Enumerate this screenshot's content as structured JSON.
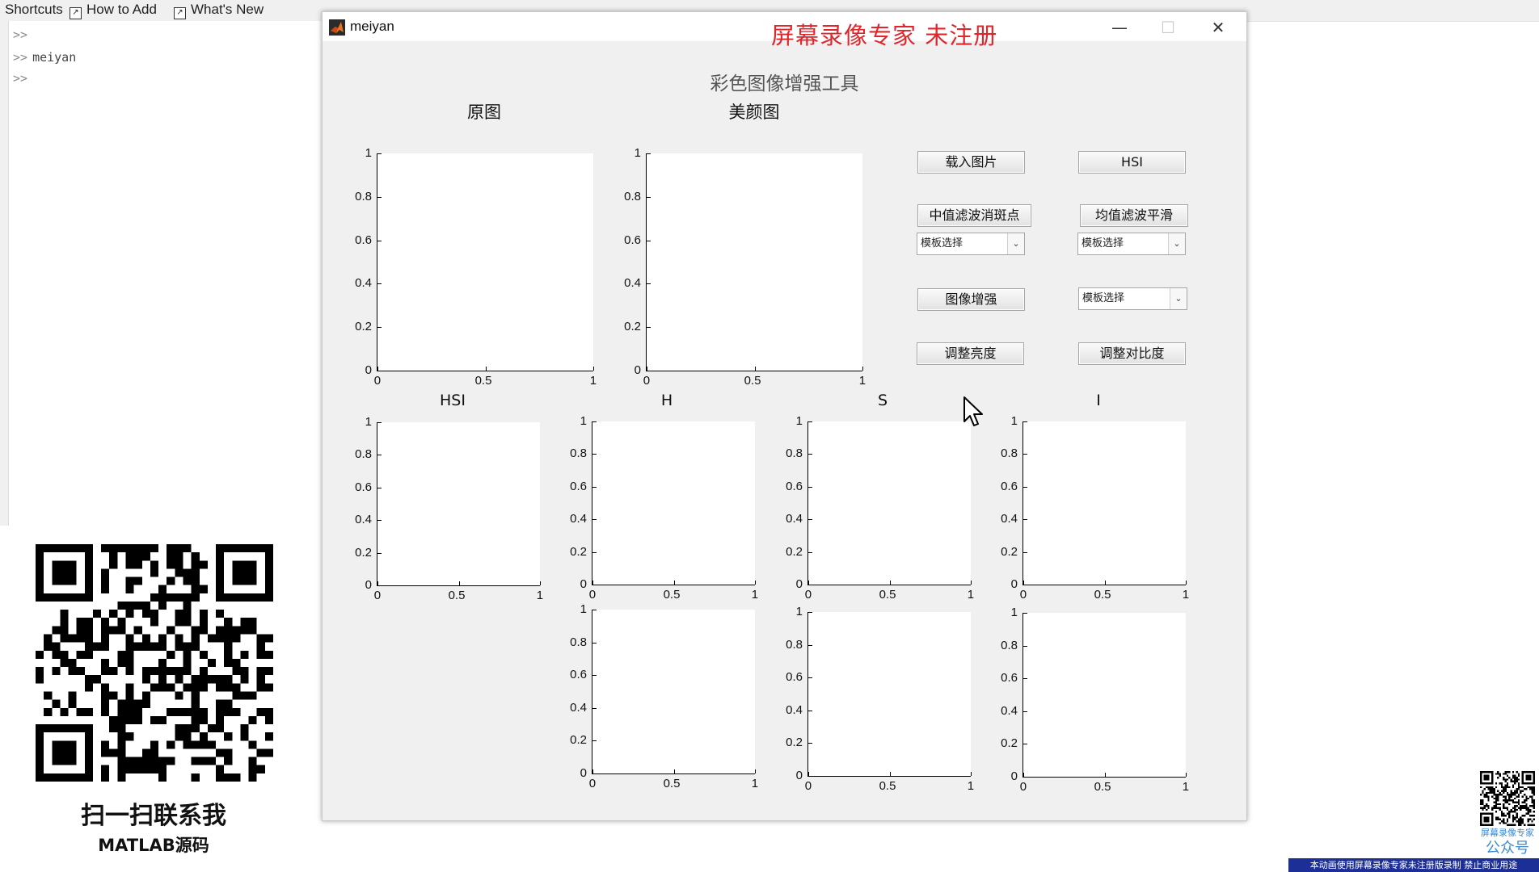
{
  "toolbar": {
    "shortcuts": "Shortcuts",
    "how_to_add": "How to Add",
    "whats_new": "What's New"
  },
  "command_window": {
    "prompt": ">>",
    "lines": [
      "",
      "meiyan",
      ""
    ]
  },
  "figure": {
    "window_title": "meiyan",
    "watermark": "屏幕录像专家  未注册",
    "gui_title": "彩色图像增强工具",
    "panel_titles": {
      "original": "原图",
      "beauty": "美颜图",
      "hsi": "HSI",
      "h": "H",
      "s": "S",
      "i": "I"
    },
    "buttons": {
      "load_image": "载入图片",
      "hsi": "HSI",
      "median_filter": "中值滤波消斑点",
      "mean_filter": "均值滤波平滑",
      "image_enhance": "图像增强",
      "adjust_brightness": "调整亮度",
      "adjust_contrast": "调整对比度"
    },
    "dropdowns": {
      "median_template": "模板选择",
      "mean_template": "模板选择",
      "enhance_template": "模板选择"
    },
    "axis_ticks": {
      "y": [
        "0",
        "0.2",
        "0.4",
        "0.6",
        "0.8",
        "1"
      ],
      "x": [
        "0",
        "0.5",
        "1"
      ]
    }
  },
  "qr_left": {
    "caption": "扫一扫联系我",
    "subcaption": "MATLAB源码"
  },
  "qr_right": {
    "caption_small": "屏幕录像专家",
    "caption_large": "公众号"
  },
  "bottom_notice": "本动画使用屏幕录像专家未注册版录制  禁止商业用途",
  "colors": {
    "watermark": "#e0262b",
    "figure_bg": "#f0f0f0",
    "notice_bg": "#1c2f96"
  }
}
